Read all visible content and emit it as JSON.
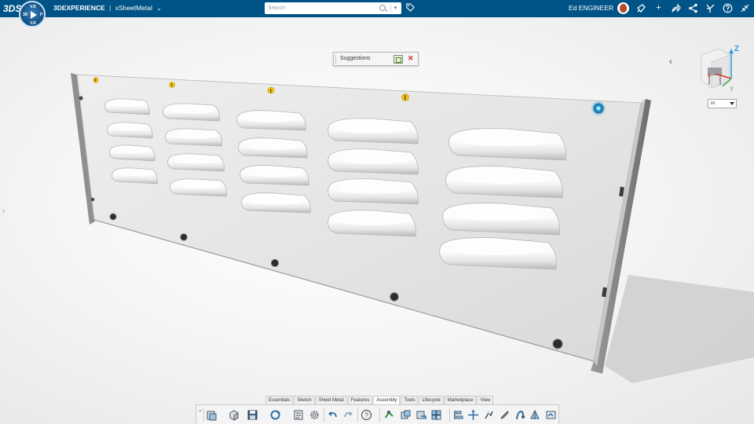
{
  "topbar": {
    "brand": "3DEXPERIENCE",
    "separator": "|",
    "app_name": "xSheetMetal",
    "search_placeholder": "Search",
    "user_name": "Ed ENGINEER",
    "compass": {
      "top": "V.R",
      "center": "3D",
      "right": "P",
      "bottom": "V.R"
    },
    "ds_logo": "3DS"
  },
  "viewport": {
    "suggestions_label": "Suggestions",
    "unit_value": "in",
    "axis_labels": {
      "z": "Z",
      "x": "x",
      "y": "y"
    }
  },
  "action_bar": {
    "tabs": [
      "Essentials",
      "Sketch",
      "Sheet Metal",
      "Features",
      "Assembly",
      "Tools",
      "Lifecycle",
      "Marketplace",
      "View"
    ],
    "active_tab": "Assembly",
    "tools": [
      "paste-icon",
      "part-icon",
      "save-icon",
      "update-icon",
      "properties-icon",
      "settings-icon",
      "undo-icon",
      "redo-icon",
      "help-icon",
      "mate-icon",
      "insert-component-icon",
      "replace-component-icon",
      "pattern-icon",
      "align-icon",
      "move-icon",
      "explode-icon",
      "fasten-icon",
      "clash-icon",
      "section-icon",
      "measure-icon"
    ]
  },
  "colors": {
    "topbar": "#005386",
    "accent": "#0f8fd3",
    "screw_marker": "#f3c614",
    "close_red": "#d0271d"
  }
}
